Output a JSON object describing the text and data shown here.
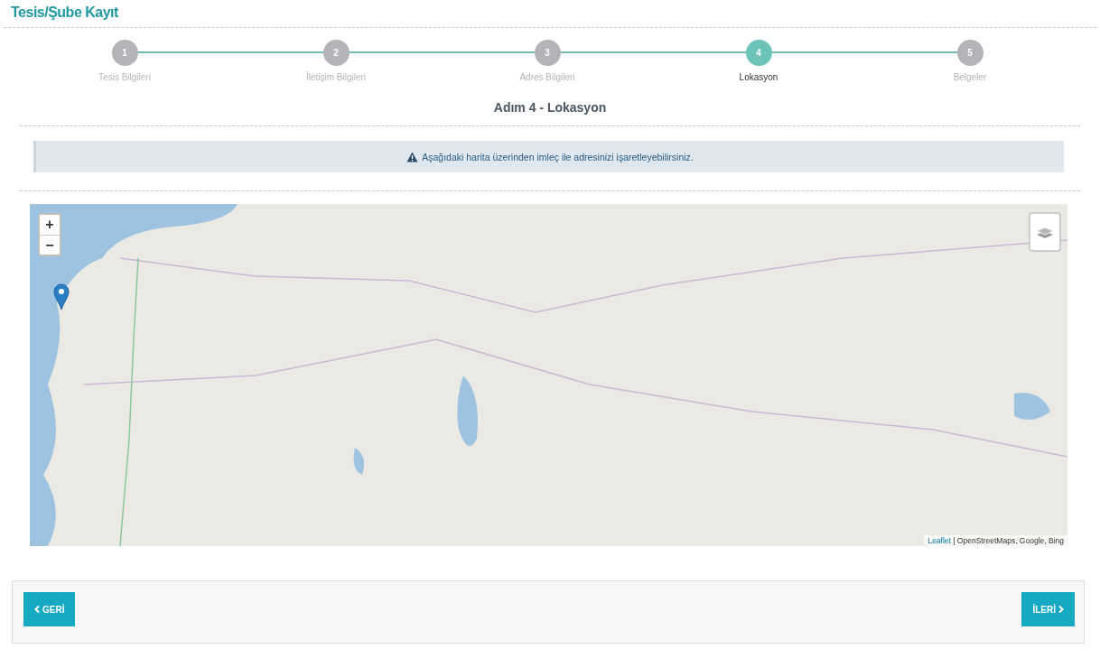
{
  "page_title": "Tesis/Şube Kayıt",
  "steps": [
    {
      "number": "1",
      "label": "Tesis Bilgileri",
      "selected": false
    },
    {
      "number": "2",
      "label": "İletişim Bilgileri",
      "selected": false
    },
    {
      "number": "3",
      "label": "Adres Bilgileri",
      "selected": false
    },
    {
      "number": "4",
      "label": "Lokasyon",
      "selected": true
    },
    {
      "number": "5",
      "label": "Belgeler",
      "selected": false
    }
  ],
  "step_heading": "Adım 4 - Lokasyon",
  "alert": {
    "text": "Aşağıdaki harita üzerinden imleç ile adresinizi işaretleyebilirsiniz."
  },
  "map": {
    "zoom_in": "+",
    "zoom_out": "−",
    "attribution_link": "Leaflet",
    "attribution": " | OpenStreetMaps, Google, Bing"
  },
  "buttons": {
    "back": "GERİ",
    "next": "İLERİ"
  }
}
